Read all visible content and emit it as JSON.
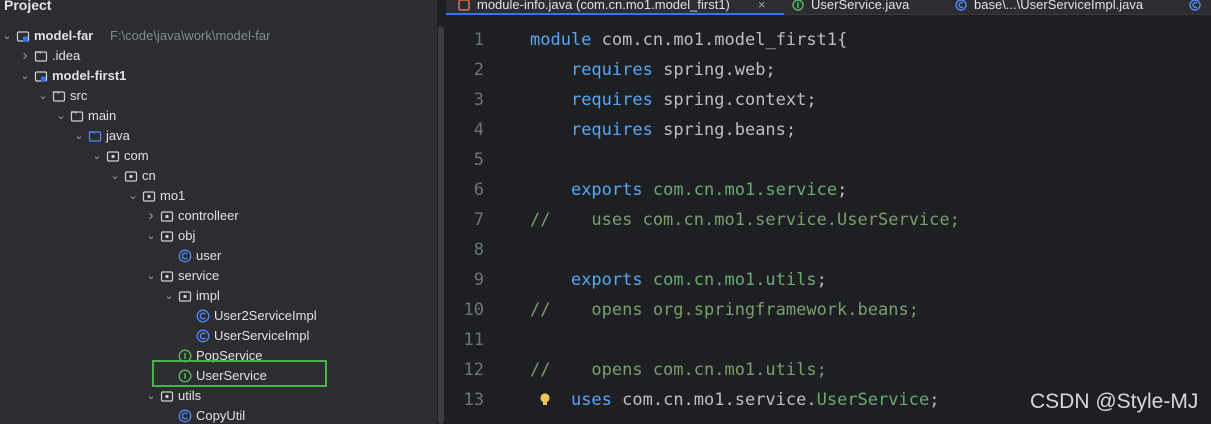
{
  "project_panel": {
    "title": "Project",
    "tree": [
      {
        "label": "model-far",
        "path": "F:\\code\\java\\work\\model-far",
        "icon": "module-folder-icon",
        "expanded": true,
        "bold": true
      },
      {
        "label": ".idea",
        "icon": "folder-icon",
        "expanded": false
      },
      {
        "label": "model-first1",
        "icon": "module-folder-icon",
        "expanded": true,
        "bold": true
      },
      {
        "label": "src",
        "icon": "folder-icon",
        "expanded": true
      },
      {
        "label": "main",
        "icon": "folder-icon",
        "expanded": true
      },
      {
        "label": "java",
        "icon": "source-folder-icon",
        "expanded": true
      },
      {
        "label": "com",
        "icon": "package-icon",
        "expanded": true
      },
      {
        "label": "cn",
        "icon": "package-icon",
        "expanded": true
      },
      {
        "label": "mo1",
        "icon": "package-icon",
        "expanded": true
      },
      {
        "label": "controlleer",
        "icon": "package-icon",
        "expanded": false
      },
      {
        "label": "obj",
        "icon": "package-icon",
        "expanded": true
      },
      {
        "label": "user",
        "icon": "class-icon"
      },
      {
        "label": "service",
        "icon": "package-icon",
        "expanded": true
      },
      {
        "label": "impl",
        "icon": "package-icon",
        "expanded": true
      },
      {
        "label": "User2ServiceImpl",
        "icon": "class-icon"
      },
      {
        "label": "UserServiceImpl",
        "icon": "class-icon"
      },
      {
        "label": "PopService",
        "icon": "interface-icon"
      },
      {
        "label": "UserService",
        "icon": "interface-icon",
        "selected": true
      },
      {
        "label": "utils",
        "icon": "package-icon",
        "expanded": true
      },
      {
        "label": "CopyUtil",
        "icon": "class-icon"
      }
    ]
  },
  "tabs": [
    {
      "label": "module-info.java (com.cn.mo1.model_first1)",
      "icon": "java-file-icon",
      "active": true,
      "close": "×"
    },
    {
      "label": "UserService.java",
      "icon": "interface-icon"
    },
    {
      "label": "base\\...\\UserServiceImpl.java",
      "icon": "class-icon"
    },
    {
      "label": "",
      "icon": "class-icon"
    }
  ],
  "code": [
    {
      "n": "1",
      "tokens": [
        [
          "kw",
          "module "
        ],
        [
          "id",
          "com.cn."
        ],
        [
          "id",
          "mo1"
        ],
        [
          "id",
          "."
        ],
        [
          "id",
          "model_first1"
        ],
        [
          "id",
          "{"
        ]
      ]
    },
    {
      "n": "2",
      "tokens": [
        [
          "id",
          "    "
        ],
        [
          "kw",
          "requires "
        ],
        [
          "id",
          "spring.web;"
        ]
      ]
    },
    {
      "n": "3",
      "tokens": [
        [
          "id",
          "    "
        ],
        [
          "kw",
          "requires "
        ],
        [
          "id",
          "spring.context;"
        ]
      ]
    },
    {
      "n": "4",
      "tokens": [
        [
          "id",
          "    "
        ],
        [
          "kw",
          "requires "
        ],
        [
          "id",
          "spring.beans;"
        ]
      ]
    },
    {
      "n": "5",
      "tokens": []
    },
    {
      "n": "6",
      "tokens": [
        [
          "id",
          "    "
        ],
        [
          "kw",
          "exports "
        ],
        [
          "cls",
          "com.cn.mo1.service"
        ],
        [
          "id",
          ";"
        ]
      ]
    },
    {
      "n": "7",
      "tokens": [
        [
          "cm",
          "//    uses com.cn.mo1.service.UserService;"
        ]
      ]
    },
    {
      "n": "8",
      "tokens": []
    },
    {
      "n": "9",
      "tokens": [
        [
          "id",
          "    "
        ],
        [
          "kw",
          "exports "
        ],
        [
          "cls",
          "com.cn.mo1.utils"
        ],
        [
          "id",
          ";"
        ]
      ]
    },
    {
      "n": "10",
      "tokens": [
        [
          "cm",
          "//    opens org.springframework.beans;"
        ]
      ]
    },
    {
      "n": "11",
      "tokens": []
    },
    {
      "n": "12",
      "tokens": [
        [
          "cm",
          "//    opens com.cn.mo1.utils;"
        ]
      ]
    },
    {
      "n": "13",
      "tokens": [
        [
          "id",
          "    "
        ],
        [
          "kw",
          "uses "
        ],
        [
          "id",
          "com.cn.mo1.service."
        ],
        [
          "cls",
          "UserService"
        ],
        [
          "id",
          ";"
        ]
      ],
      "bulb": true
    }
  ],
  "watermark": "CSDN @Style-MJ",
  "colors": {
    "keyword": "#56a8f5",
    "comment": "#7a9e6d",
    "selection_box": "#4bb050",
    "class_icon": "#548af7",
    "interface_icon": "#5fb865"
  }
}
